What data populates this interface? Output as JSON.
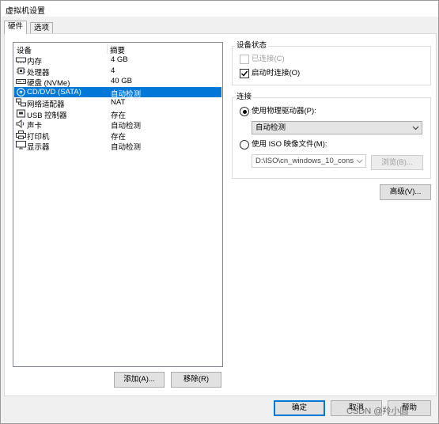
{
  "window": {
    "title": "虚拟机设置"
  },
  "tabs": [
    {
      "label": "硬件",
      "active": true
    },
    {
      "label": "选项",
      "active": false
    }
  ],
  "device_list": {
    "columns": [
      "设备",
      "摘要"
    ],
    "rows": [
      {
        "name": "内存",
        "summary": "4 GB",
        "icon": "memory-icon",
        "selected": false
      },
      {
        "name": "处理器",
        "summary": "4",
        "icon": "processor-icon",
        "selected": false
      },
      {
        "name": "硬盘 (NVMe)",
        "summary": "40 GB",
        "icon": "hard-disk-icon",
        "selected": false
      },
      {
        "name": "CD/DVD (SATA)",
        "summary": "自动检测",
        "icon": "cd-dvd-icon",
        "selected": true
      },
      {
        "name": "网络适配器",
        "summary": "NAT",
        "icon": "network-adapter-icon",
        "selected": false
      },
      {
        "name": "USB 控制器",
        "summary": "存在",
        "icon": "usb-icon",
        "selected": false
      },
      {
        "name": "声卡",
        "summary": "自动检测",
        "icon": "speaker-icon",
        "selected": false
      },
      {
        "name": "打印机",
        "summary": "存在",
        "icon": "printer-icon",
        "selected": false
      },
      {
        "name": "显示器",
        "summary": "自动检测",
        "icon": "monitor-icon",
        "selected": false
      }
    ],
    "add_label": "添加(A)...",
    "remove_label": "移除(R)"
  },
  "device_status": {
    "title": "设备状态",
    "connected": {
      "label": "已连接(C)",
      "checked": false,
      "enabled": false
    },
    "connect_at_power_on": {
      "label": "启动时连接(O)",
      "checked": true,
      "enabled": true
    }
  },
  "connection": {
    "title": "连接",
    "use_physical_drive": {
      "label": "使用物理驱动器(P):",
      "selected": true
    },
    "physical_drive_value": "自动检测",
    "use_iso": {
      "label": "使用 ISO 映像文件(M):",
      "selected": false
    },
    "iso_path": "D:\\ISO\\cn_windows_10_conso",
    "browse_label": "浏览(B)..."
  },
  "advanced_label": "高级(V)...",
  "footer": {
    "ok_label": "确定",
    "cancel_label": "取消",
    "help_label": "帮助"
  },
  "watermark": "CSDN @羚小圆",
  "colors": {
    "selection": "#0078d7",
    "window_bg": "#f0f0f0"
  }
}
